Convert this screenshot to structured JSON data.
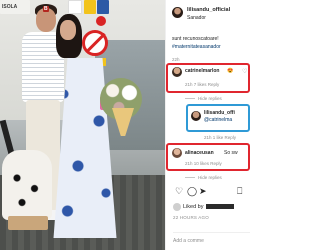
{
  "photo": {
    "sign_text": "ISOLA",
    "cap_letter": "B"
  },
  "post": {
    "owner": "lilisandu_official",
    "owner_sub": "Sanador",
    "caption_lines": [
      "sunt recunoscatoare!",
      "#maternitateasanador"
    ],
    "caption_age": "22h"
  },
  "comments": [
    {
      "user": "catrinelmarlon",
      "text": "😍",
      "meta": "21h  7 likes  Reply",
      "highlight": "red"
    },
    {
      "hide_replies": "Hide replies"
    },
    {
      "user": "lilisandu_offi",
      "text": "@catrinelma",
      "meta": "21h  1 like  Reply",
      "highlight": "blue"
    },
    {
      "user": "alinaceusan",
      "text": "So sw",
      "meta": "21h  10 likes  Reply",
      "highlight": "red"
    },
    {
      "hide_replies": "Hide replies"
    }
  ],
  "actions": {
    "like_icon": "heart-outline-icon",
    "comment_icon": "comment-icon",
    "share_icon": "share-icon",
    "save_icon": "bookmark-icon"
  },
  "liked_by": {
    "prefix": "Liked by"
  },
  "date": "22 HOURS AGO",
  "add_comment": {
    "placeholder": "Add a comme"
  }
}
